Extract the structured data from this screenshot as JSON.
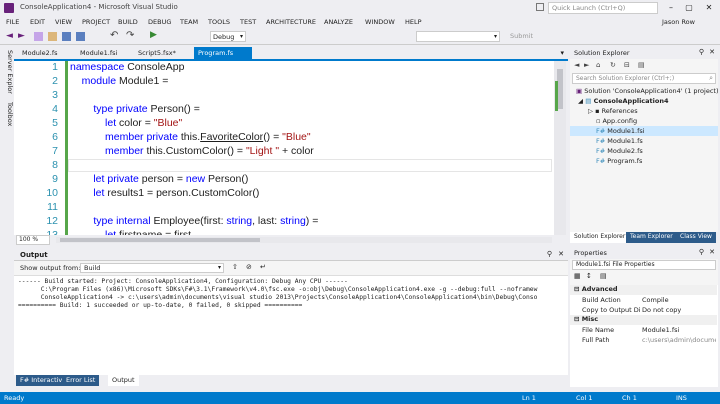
{
  "title": "ConsoleApplication4 - Microsoft Visual Studio",
  "quick_launch": "Quick Launch (Ctrl+Q)",
  "user": "Jason Row",
  "menu": [
    "FILE",
    "EDIT",
    "VIEW",
    "PROJECT",
    "BUILD",
    "DEBUG",
    "TEAM",
    "TOOLS",
    "TEST",
    "ARCHITECTURE",
    "ANALYZE",
    "WINDOW",
    "HELP"
  ],
  "toolbar": {
    "config": "Debug",
    "submit": "Submit"
  },
  "side_tabs": [
    "Server Explorer",
    "Toolbox"
  ],
  "doc_tabs": [
    "Module2.fs",
    "Module1.fsi",
    "Script5.fsx*",
    "Program.fs"
  ],
  "code_lines": [
    {
      "n": "1",
      "t": "namespace ConsoleApp"
    },
    {
      "n": "2",
      "t": "    module Module1 ="
    },
    {
      "n": "3",
      "t": ""
    },
    {
      "n": "4",
      "t": "        type private Person() ="
    },
    {
      "n": "5",
      "t": "            let color = \"Blue\""
    },
    {
      "n": "6",
      "t": "            member private this.FavoriteColor() = \"Blue\""
    },
    {
      "n": "7",
      "t": "            member this.CustomColor() = \"Light \" + color"
    },
    {
      "n": "8",
      "t": ""
    },
    {
      "n": "9",
      "t": "        let private person = new Person()"
    },
    {
      "n": "10",
      "t": "        let results1 = person.CustomColor()"
    },
    {
      "n": "11",
      "t": ""
    },
    {
      "n": "12",
      "t": "        type internal Employee(first: string, last: string) ="
    },
    {
      "n": "13",
      "t": "            let firstname = first"
    }
  ],
  "zoom": "100 %",
  "output": {
    "title": "Output",
    "show_from_label": "Show output from:",
    "show_from_value": "Build",
    "lines": [
      "------ Build started: Project: ConsoleApplication4, Configuration: Debug Any CPU ------",
      "      C:\\Program Files (x86)\\Microsoft SDKs\\F#\\3.1\\Framework\\v4.0\\fsc.exe -o:obj\\Debug\\ConsoleApplication4.exe -g --debug:full --noframew",
      "      ConsoleApplication4 -> c:\\users\\admin\\documents\\visual studio 2013\\Projects\\ConsoleApplication4\\ConsoleApplication4\\bin\\Debug\\Conso",
      "========== Build: 1 succeeded or up-to-date, 0 failed, 0 skipped =========="
    ],
    "tabs": [
      "F# Interactive",
      "Error List",
      "Output"
    ]
  },
  "solution_explorer": {
    "title": "Solution Explorer",
    "search": "Search Solution Explorer (Ctrl+;)",
    "items": [
      {
        "label": "Solution 'ConsoleApplication4' (1 project)",
        "indent": 0,
        "bold": false
      },
      {
        "label": "ConsoleApplication4",
        "indent": 1,
        "bold": true
      },
      {
        "label": "References",
        "indent": 2,
        "bold": false
      },
      {
        "label": "App.config",
        "indent": 2,
        "bold": false
      },
      {
        "label": "Module1.fsi",
        "indent": 2,
        "bold": false
      },
      {
        "label": "Module1.fs",
        "indent": 2,
        "bold": false
      },
      {
        "label": "Module2.fs",
        "indent": 2,
        "bold": false
      },
      {
        "label": "Program.fs",
        "indent": 2,
        "bold": false
      }
    ],
    "tabs": [
      "Solution Explorer",
      "Team Explorer",
      "Class View"
    ]
  },
  "properties": {
    "title": "Properties",
    "object": "Module1.fsi  File Properties",
    "sections": [
      {
        "name": "Advanced",
        "rows": [
          [
            "Build Action",
            "Compile"
          ],
          [
            "Copy to Output Directory",
            "Do not copy"
          ]
        ]
      },
      {
        "name": "Misc",
        "rows": [
          [
            "File Name",
            "Module1.fsi"
          ],
          [
            "Full Path",
            "c:\\users\\admin\\docume"
          ]
        ]
      }
    ]
  },
  "status": {
    "ready": "Ready",
    "ln": "Ln 1",
    "col": "Col 1",
    "ch": "Ch 1",
    "mode": "INS"
  },
  "colors": {
    "accent": "#007acc",
    "tab_active": "#007acc",
    "selected": "#cce8ff"
  }
}
